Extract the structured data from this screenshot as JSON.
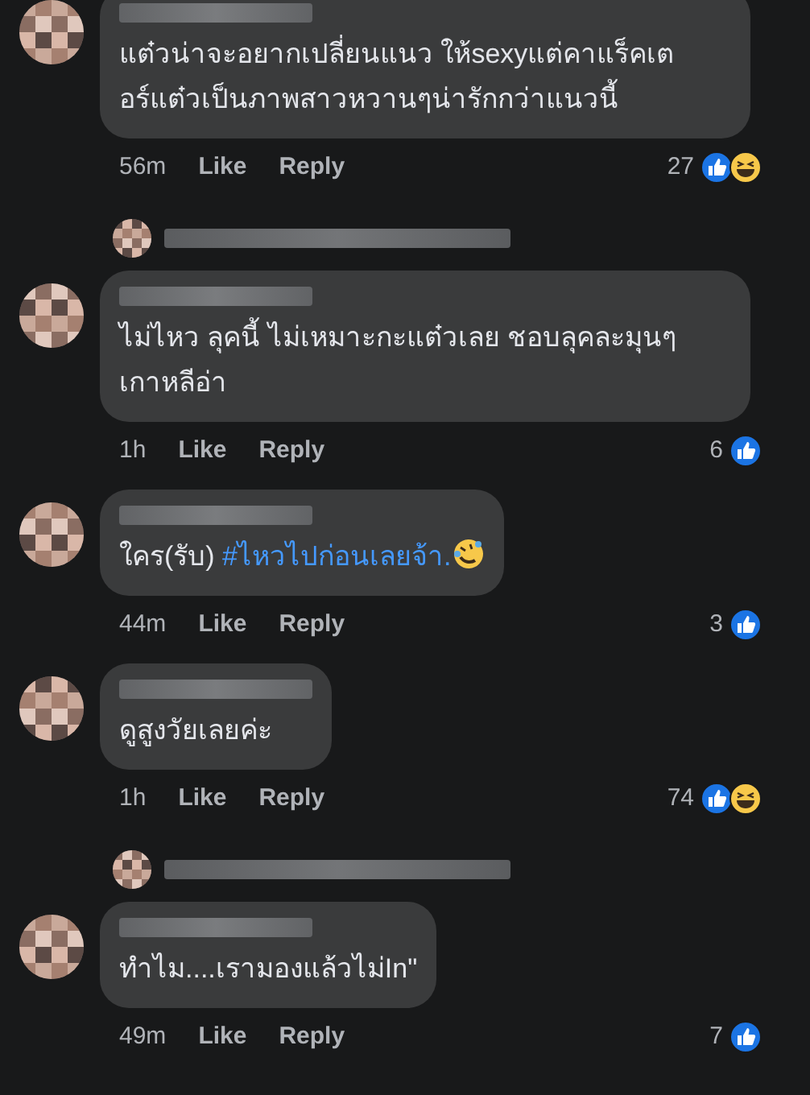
{
  "thread": [
    {
      "kind": "comment",
      "parts": [
        {
          "kind": "text",
          "text": "แต๋วน่าจะอยากเปลี่ยนแนว ให้sexyแต่คาแร็คเตอร์แต๋วเป็นภาพสาวหวานๆน่ารักกว่าแนวนี้"
        }
      ],
      "time": "56m",
      "like": "Like",
      "reply": "Reply",
      "count": "27",
      "reactions": [
        {
          "kind": "like"
        },
        {
          "kind": "haha"
        }
      ]
    },
    {
      "kind": "replies_link"
    },
    {
      "kind": "comment",
      "parts": [
        {
          "kind": "text",
          "text": "ไม่ไหว ลุคนี้ ไม่เหมาะกะแต๋วเลย ชอบลุคละมุนๆเกาหลีอ่า"
        }
      ],
      "time": "1h",
      "like": "Like",
      "reply": "Reply",
      "count": "6",
      "reactions": [
        {
          "kind": "like"
        }
      ]
    },
    {
      "kind": "comment",
      "parts": [
        {
          "kind": "text",
          "text": "ใคร(รับ) "
        },
        {
          "kind": "hashtag",
          "text": "#ไหวไปก่อนเลยจ้า."
        },
        {
          "kind": "emoji"
        }
      ],
      "time": "44m",
      "like": "Like",
      "reply": "Reply",
      "count": "3",
      "reactions": [
        {
          "kind": "like"
        }
      ]
    },
    {
      "kind": "comment",
      "parts": [
        {
          "kind": "text",
          "text": "ดูสูงวัยเลยค่ะ"
        }
      ],
      "time": "1h",
      "like": "Like",
      "reply": "Reply",
      "count": "74",
      "reactions": [
        {
          "kind": "like"
        },
        {
          "kind": "haha"
        }
      ]
    },
    {
      "kind": "replies_link"
    },
    {
      "kind": "comment",
      "parts": [
        {
          "kind": "text",
          "text": "ทำไม....เรามองแล้วไม่In\""
        }
      ],
      "time": "49m",
      "like": "Like",
      "reply": "Reply",
      "count": "7",
      "reactions": [
        {
          "kind": "like"
        }
      ]
    }
  ]
}
